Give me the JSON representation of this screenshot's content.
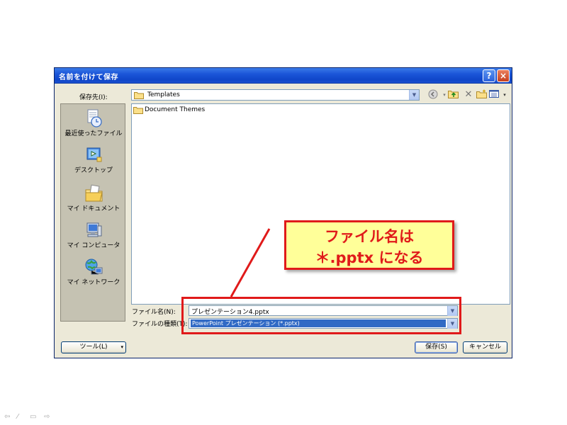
{
  "dialog": {
    "title": "名前を付けて保存",
    "help_glyph": "?",
    "close_glyph": "×"
  },
  "save_in": {
    "label": "保存先(I):",
    "value": "Templates"
  },
  "toolbar_icons": [
    "back-icon",
    "up-folder-icon",
    "delete-icon",
    "new-folder-icon",
    "views-icon"
  ],
  "places": [
    {
      "label": "最近使ったファイル",
      "icon": "recent-documents-icon"
    },
    {
      "label": "デスクトップ",
      "icon": "desktop-icon"
    },
    {
      "label": "マイ ドキュメント",
      "icon": "my-documents-icon"
    },
    {
      "label": "マイ コンピュータ",
      "icon": "my-computer-icon"
    },
    {
      "label": "マイ ネットワーク",
      "icon": "my-network-icon"
    }
  ],
  "files": [
    {
      "name": "Document Themes",
      "icon": "folder-icon"
    }
  ],
  "filename": {
    "label": "ファイル名(N):",
    "value": "プレゼンテーション4.pptx"
  },
  "filetype": {
    "label": "ファイルの種類(T):",
    "value": "PowerPoint プレゼンテーション (*.pptx)"
  },
  "buttons": {
    "tools": "ツール(L)",
    "save": "保存(S)",
    "cancel": "キャンセル"
  },
  "callout": {
    "line1": "ファイル名は",
    "line2": "＊.pptx になる"
  },
  "colors": {
    "annotation": "#e01a1a",
    "callout_fill": "#ffff99",
    "titlebar": "#1b55d8",
    "selection": "#316ac5"
  }
}
